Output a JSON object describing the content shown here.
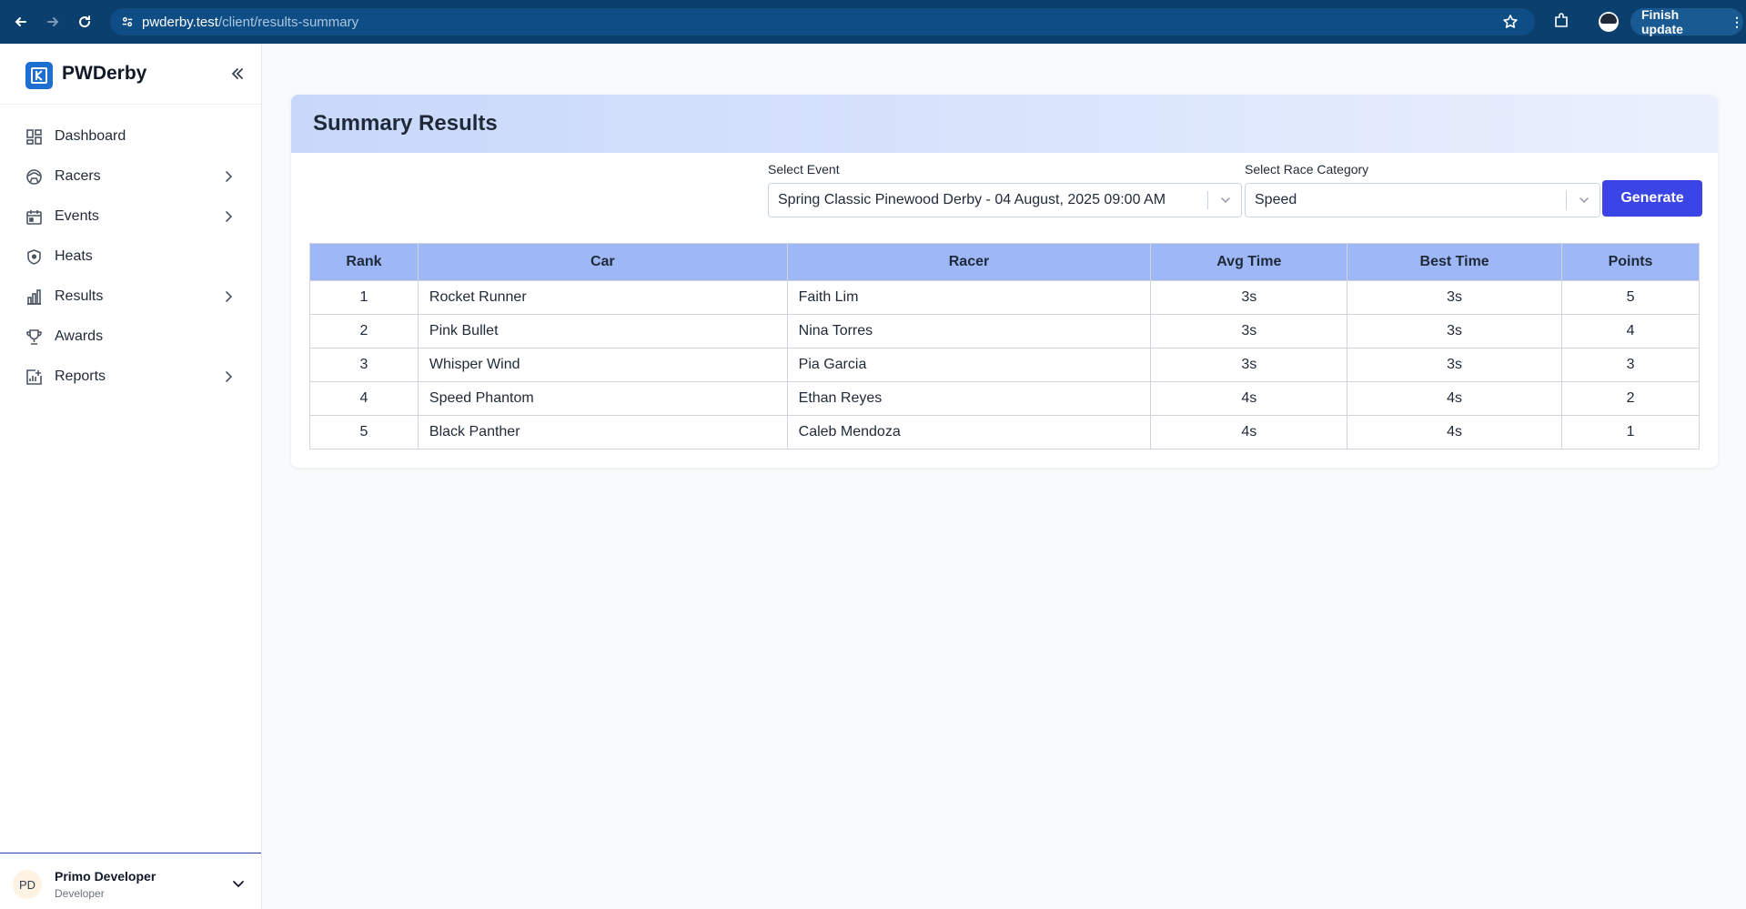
{
  "browser": {
    "url_host": "pwderby.test",
    "url_path": "/client/results-summary",
    "finish_update_label": "Finish update"
  },
  "sidebar": {
    "brand_name": "PWDerby",
    "items": [
      {
        "label": "Dashboard",
        "icon": "dashboard-icon",
        "has_chevron": false
      },
      {
        "label": "Racers",
        "icon": "racers-icon",
        "has_chevron": true
      },
      {
        "label": "Events",
        "icon": "calendar-icon",
        "has_chevron": true
      },
      {
        "label": "Heats",
        "icon": "shield-icon",
        "has_chevron": false
      },
      {
        "label": "Results",
        "icon": "bar-chart-icon",
        "has_chevron": true
      },
      {
        "label": "Awards",
        "icon": "trophy-icon",
        "has_chevron": false
      },
      {
        "label": "Reports",
        "icon": "report-icon",
        "has_chevron": true
      }
    ],
    "user": {
      "initials": "PD",
      "name": "Primo Developer",
      "role": "Developer"
    }
  },
  "main": {
    "title": "Summary Results",
    "event_label": "Select Event",
    "event_value": "Spring Classic Pinewood Derby - 04 August, 2025 09:00 AM",
    "category_label": "Select Race Category",
    "category_value": "Speed",
    "generate_label": "Generate",
    "table": {
      "columns": [
        "Rank",
        "Car",
        "Racer",
        "Avg Time",
        "Best Time",
        "Points"
      ],
      "rows": [
        [
          "1",
          "Rocket Runner",
          "Faith Lim",
          "3s",
          "3s",
          "5"
        ],
        [
          "2",
          "Pink Bullet",
          "Nina Torres",
          "3s",
          "3s",
          "4"
        ],
        [
          "3",
          "Whisper Wind",
          "Pia Garcia",
          "3s",
          "3s",
          "3"
        ],
        [
          "4",
          "Speed Phantom",
          "Ethan Reyes",
          "4s",
          "4s",
          "2"
        ],
        [
          "5",
          "Black Panther",
          "Caleb Mendoza",
          "4s",
          "4s",
          "1"
        ]
      ]
    }
  },
  "colors": {
    "browser_bar": "#0b3f6e",
    "header_gradient_start": "#c8d8fb",
    "table_header": "#9db7f7",
    "generate_button": "#3b45e6",
    "brand_logo": "#1d6fd0"
  }
}
